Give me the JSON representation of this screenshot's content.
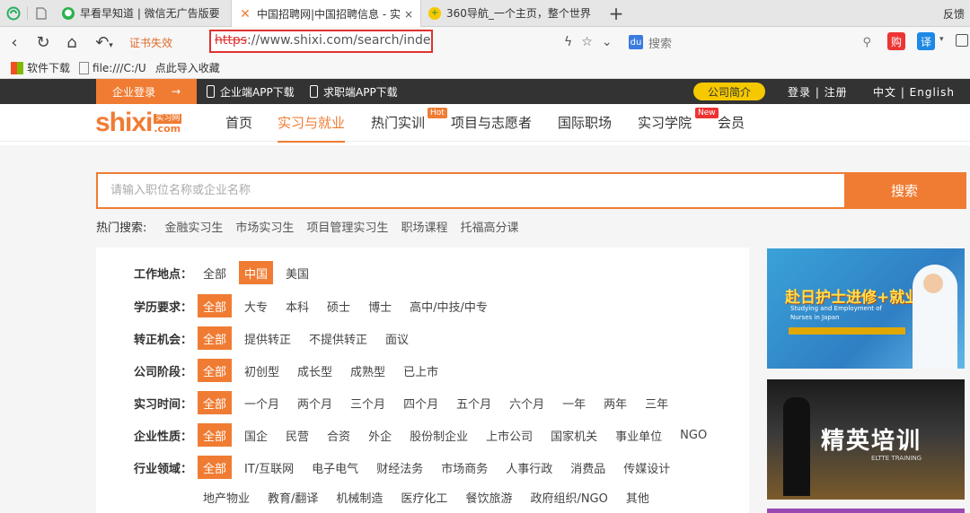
{
  "browser": {
    "tabs": [
      {
        "label": "早看早知道 | 微信无广告版要"
      },
      {
        "label": "中国招聘网|中国招聘信息 - 实",
        "close": "×"
      },
      {
        "label": "360导航_一个主页，整个世界"
      }
    ],
    "new_tab": "+",
    "feedback": "反馈",
    "cert_warning": "证书失效",
    "url_scheme": "https",
    "url_rest": "://www.shixi.com/search/index?",
    "search_placeholder": "搜索",
    "ext_gou": "购",
    "ext_yi": "译",
    "bookmarks": [
      "软件下载",
      "file:///C:/U",
      "点此导入收藏"
    ]
  },
  "site": {
    "topbar": {
      "corp_login": "企业登录",
      "arrow": "→",
      "corp_app": "企业端APP下载",
      "seeker_app": "求职端APP下载",
      "company_intro": "公司简介",
      "login_register": "登录 | 注册",
      "language": "中文 | English"
    },
    "logo": {
      "word": "shixi",
      "cn": "实习网",
      "com": ".com"
    },
    "nav": {
      "items": [
        "首页",
        "实习与就业",
        "热门实训",
        "项目与志愿者",
        "国际职场",
        "实习学院",
        "会员"
      ],
      "badge_hot": "Hot",
      "badge_new": "New"
    },
    "search": {
      "placeholder": "请输入职位名称或企业名称",
      "button": "搜索"
    },
    "hot_search": {
      "label": "热门搜索:",
      "items": [
        "金融实习生",
        "市场实习生",
        "项目管理实习生",
        "职场课程",
        "托福高分课"
      ]
    },
    "filters": [
      {
        "label": "工作地点：",
        "options": [
          "全部",
          "中国",
          "美国"
        ],
        "selected": 1
      },
      {
        "label": "学历要求：",
        "options": [
          "全部",
          "大专",
          "本科",
          "硕士",
          "博士",
          "高中/中技/中专"
        ],
        "selected": 0
      },
      {
        "label": "转正机会：",
        "options": [
          "全部",
          "提供转正",
          "不提供转正",
          "面议"
        ],
        "selected": 0
      },
      {
        "label": "公司阶段：",
        "options": [
          "全部",
          "初创型",
          "成长型",
          "成熟型",
          "已上市"
        ],
        "selected": 0
      },
      {
        "label": "实习时间：",
        "options": [
          "全部",
          "一个月",
          "两个月",
          "三个月",
          "四个月",
          "五个月",
          "六个月",
          "一年",
          "两年",
          "三年"
        ],
        "selected": 0
      },
      {
        "label": "企业性质：",
        "options": [
          "全部",
          "国企",
          "民营",
          "合资",
          "外企",
          "股份制企业",
          "上市公司",
          "国家机关",
          "事业单位",
          "NGO"
        ],
        "selected": 0
      },
      {
        "label": "行业领域：",
        "options": [
          "全部",
          "IT/互联网",
          "电子电气",
          "财经法务",
          "市场商务",
          "人事行政",
          "消费品",
          "传媒设计"
        ],
        "selected": 0
      },
      {
        "label": "",
        "options": [
          "地产物业",
          "教育/翻译",
          "机械制造",
          "医疗化工",
          "餐饮旅游",
          "政府组织/NGO",
          "其他"
        ],
        "selected": -1
      }
    ],
    "ads": {
      "ad1_title": "赴日护士进修+就业",
      "ad1_sub": "Studying and Employment of Nurses in Japan",
      "ad2_title": "精英培训",
      "ad2_sub": "ELTTE TRAINING"
    }
  },
  "colors": {
    "accent": "#f07c33",
    "dark_bar": "#333333",
    "badge_yellow": "#f5c800",
    "url_highlight": "#e03131"
  }
}
